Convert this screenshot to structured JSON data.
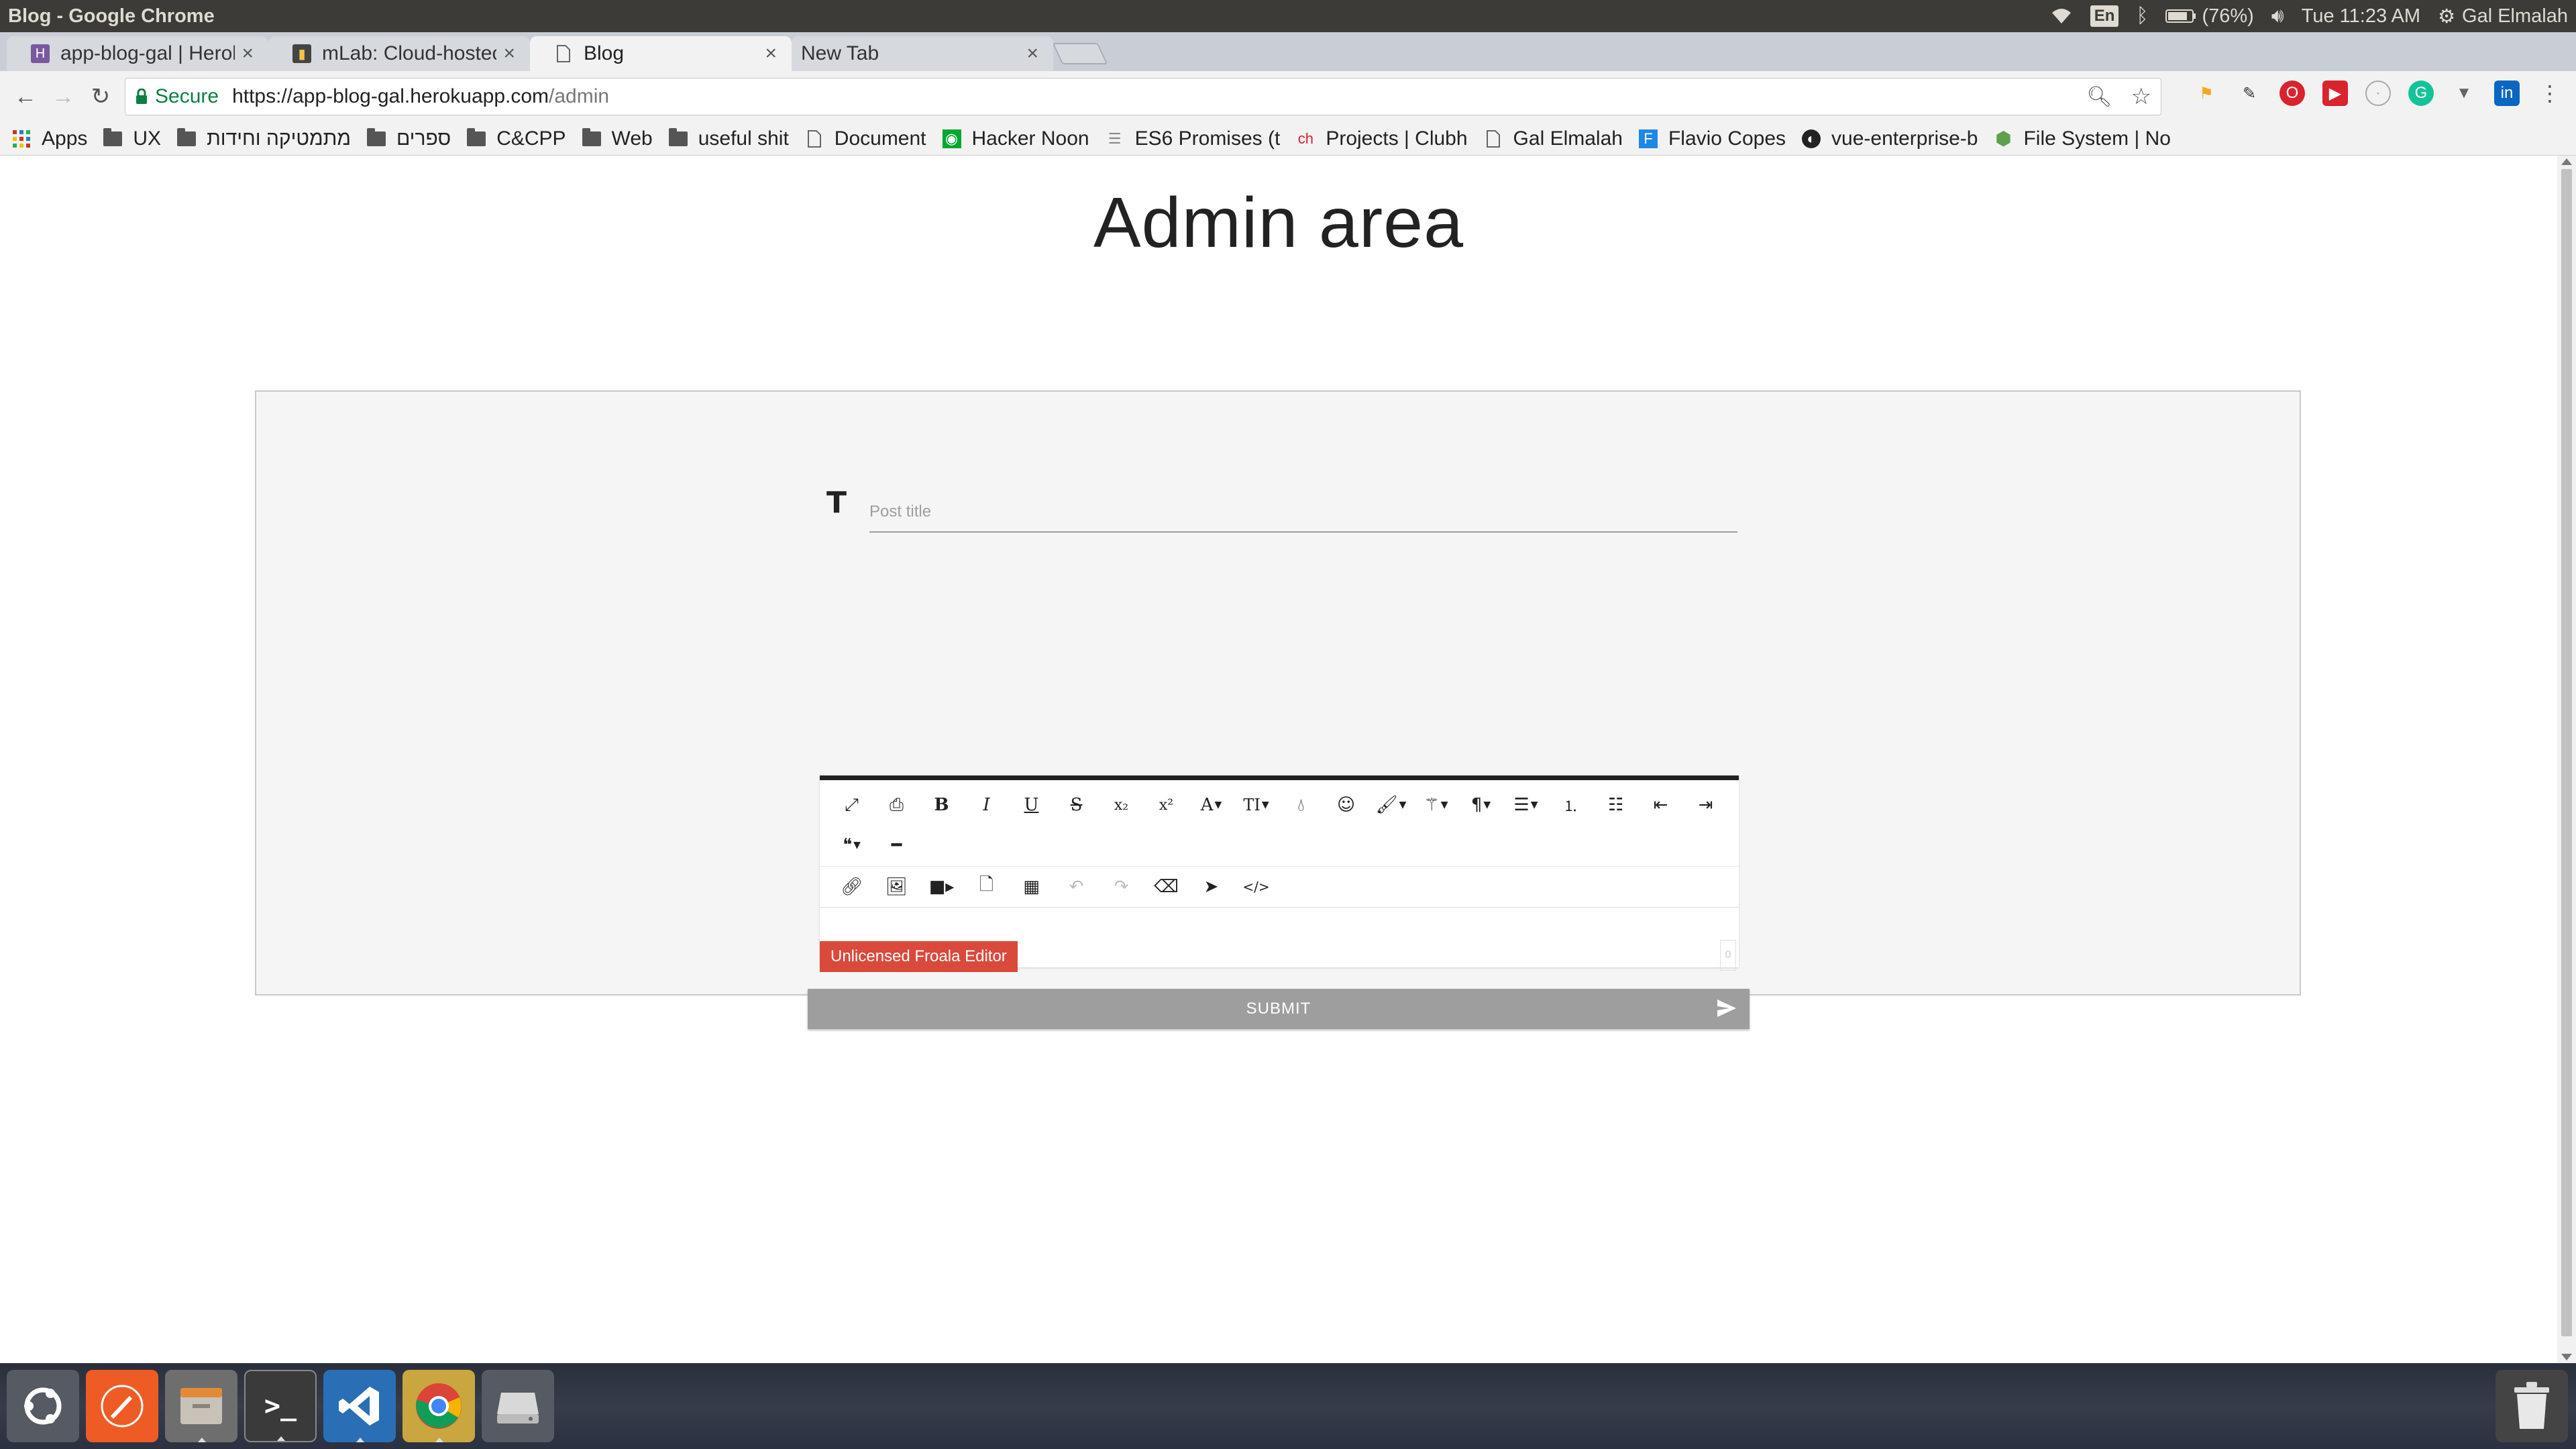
{
  "system": {
    "window_title": "Blog - Google Chrome",
    "keyboard_layout": "En",
    "battery": "(76%)",
    "clock": "Tue 11:23 AM",
    "user": "Gal Elmalah"
  },
  "tabs": [
    {
      "label": "app-blog-gal | Herol",
      "icon": "heroku-icon",
      "close": "×"
    },
    {
      "label": "mLab: Cloud-hostec",
      "icon": "mlab-icon",
      "close": "×"
    },
    {
      "label": "Blog",
      "icon": "page-icon",
      "close": "×"
    },
    {
      "label": "New Tab",
      "icon": "",
      "close": "×"
    }
  ],
  "omnibox": {
    "secure_label": "Secure",
    "url_host": "https://app-blog-gal.herokuapp.com",
    "url_path": "/admin"
  },
  "bookmarks": [
    {
      "label": "Apps",
      "icon": "apps-grid-icon"
    },
    {
      "label": "UX",
      "icon": "folder-icon"
    },
    {
      "label": "מתמטיקה וחידות",
      "icon": "folder-icon"
    },
    {
      "label": "ספרים",
      "icon": "folder-icon"
    },
    {
      "label": "C&CPP",
      "icon": "folder-icon"
    },
    {
      "label": "Web",
      "icon": "folder-icon"
    },
    {
      "label": "useful shit",
      "icon": "folder-icon"
    },
    {
      "label": "Document",
      "icon": "page-icon"
    },
    {
      "label": "Hacker Noon",
      "icon": "hackernoon-icon"
    },
    {
      "label": "ES6 Promises (t",
      "icon": "list-icon"
    },
    {
      "label": "Projects | Clubh",
      "icon": "clubhouse-icon"
    },
    {
      "label": "Gal Elmalah",
      "icon": "page-icon"
    },
    {
      "label": "Flavio Copes",
      "icon": "flavio-icon"
    },
    {
      "label": "vue-enterprise-b",
      "icon": "github-icon"
    },
    {
      "label": "File System | No",
      "icon": "nodejs-icon"
    }
  ],
  "page": {
    "heading": "Admin area",
    "title_icon": "T",
    "title_placeholder": "Post title",
    "froala_badge": "Unlicensed Froala Editor",
    "char_count": "0",
    "submit_label": "SUBMIT"
  },
  "editor_toolbar": {
    "row1": [
      "fullscreen-icon",
      "print-icon",
      "bold-icon",
      "italic-icon",
      "underline-icon",
      "strikethrough-icon",
      "subscript-icon",
      "superscript-icon",
      "font-family-icon",
      "font-size-icon",
      "color-icon",
      "emoticons-icon",
      "paint-brush-icon",
      "magic-wand-icon",
      "paragraph-format-icon",
      "align-icon",
      "ordered-list-icon",
      "unordered-list-icon",
      "outdent-icon",
      "indent-icon"
    ],
    "row2": [
      "quote-icon",
      "horizontal-line-icon"
    ],
    "row3": [
      "link-icon",
      "image-icon",
      "video-icon",
      "file-icon",
      "table-icon",
      "undo-icon",
      "redo-icon",
      "clear-formatting-icon",
      "select-all-icon",
      "code-view-icon"
    ]
  },
  "dock": [
    "ubuntu-dash-icon",
    "postman-icon",
    "files-icon",
    "terminal-icon",
    "vscode-icon",
    "chrome-icon",
    "disk-icon",
    "trash-icon"
  ]
}
